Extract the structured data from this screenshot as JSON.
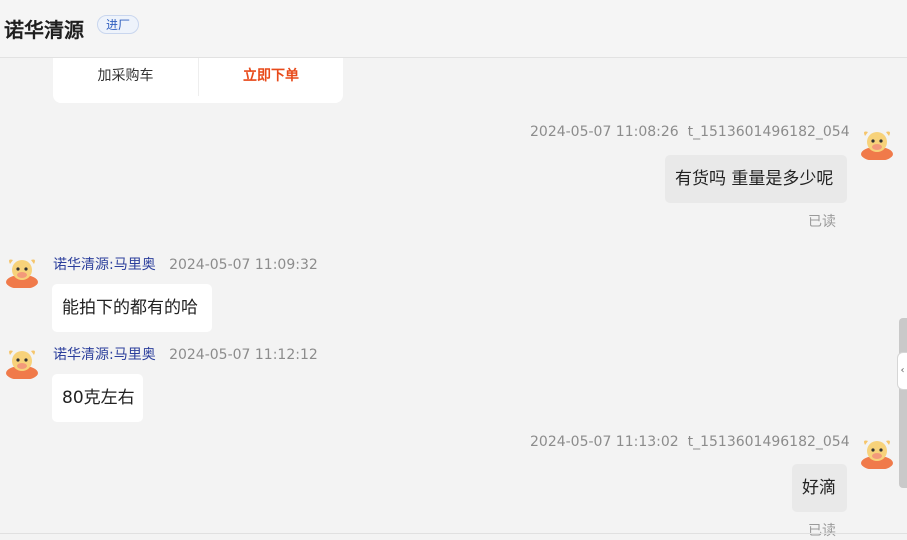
{
  "header": {
    "shop_name": "诺华清源",
    "badge": "进厂"
  },
  "card": {
    "add_cart": "加采购车",
    "order_now": "立即下单"
  },
  "messages": [
    {
      "time": "2024-05-07 11:08:26",
      "user": "t_1513601496182_054",
      "text": "有货吗 重量是多少呢",
      "status": "已读"
    },
    {
      "sender": "诺华清源:马里奥",
      "time": "2024-05-07 11:09:32",
      "text": "能拍下的都有的哈"
    },
    {
      "sender": "诺华清源:马里奥",
      "time": "2024-05-07 11:12:12",
      "text": "80克左右"
    },
    {
      "time": "2024-05-07 11:13:02",
      "user": "t_1513601496182_054",
      "text": "好滴",
      "status": "已读"
    }
  ],
  "icons": {
    "avatar": "cow-avatar-icon",
    "collapse": "chevron-left-icon"
  },
  "colors": {
    "accent_orange": "#e84a1a",
    "sender_blue": "#2c3f9c",
    "badge_blue": "#2f5fbf",
    "avatar_orange": "#f07a4a"
  }
}
